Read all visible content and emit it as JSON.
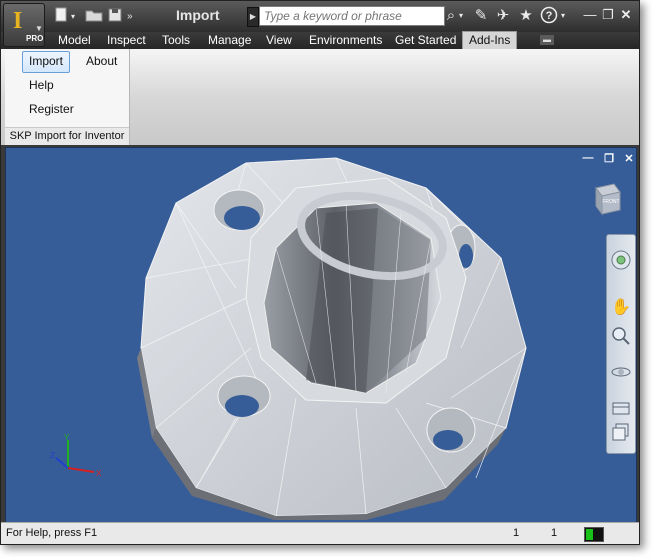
{
  "window": {
    "document_title": "Import",
    "search": {
      "placeholder": "Type a keyword or phrase"
    },
    "app_badge": "PRO"
  },
  "menu": {
    "items": [
      "Model",
      "Inspect",
      "Tools",
      "Manage",
      "View",
      "Environments",
      "Get Started",
      "Add-Ins"
    ],
    "active": "Add-Ins"
  },
  "ribbon": {
    "panel": {
      "title": "SKP Import for Inventor",
      "buttons": {
        "import": "Import",
        "about": "About",
        "help": "Help",
        "register": "Register"
      }
    }
  },
  "viewcube": {
    "face_label": "FRONT"
  },
  "status": {
    "help_text": "For Help, press F1",
    "value_1": "1",
    "value_2": "1"
  },
  "colors": {
    "viewport_background": "#365d98",
    "accent_logo": "#e7b320",
    "axis_x": "#d42020",
    "axis_y": "#20b020",
    "axis_z": "#2040d0"
  }
}
